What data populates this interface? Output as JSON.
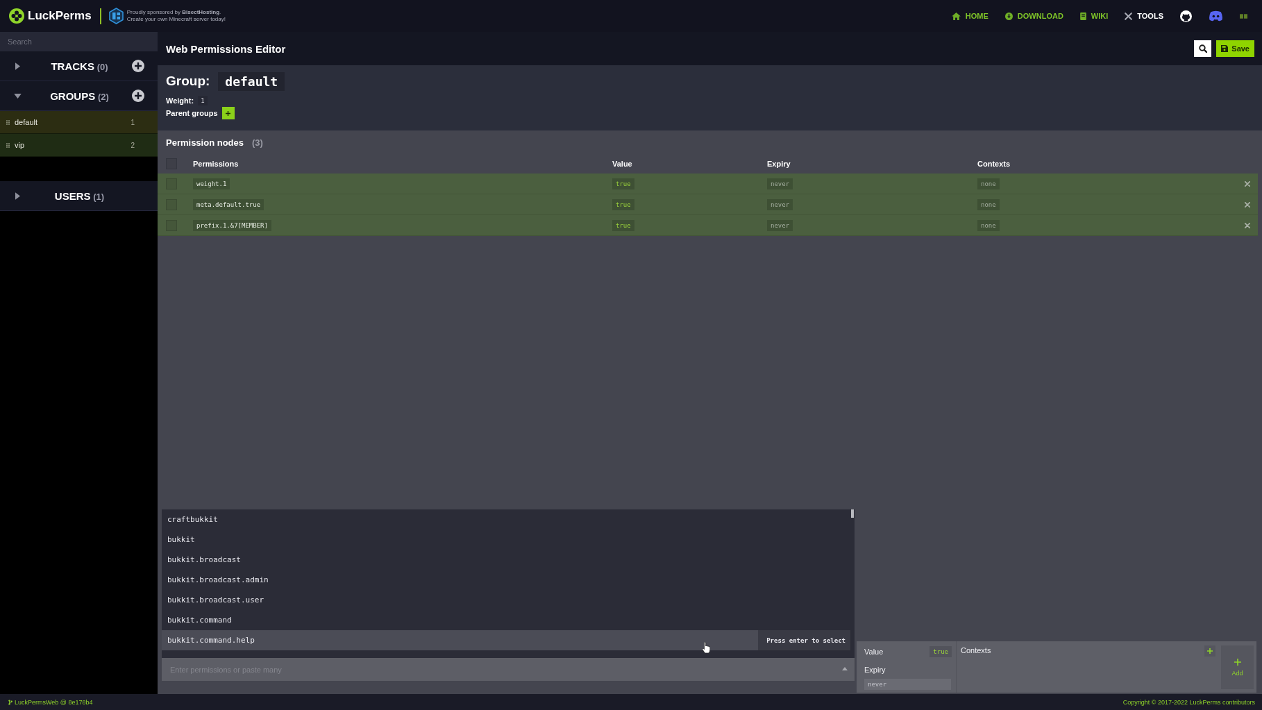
{
  "header": {
    "logo": "LuckPerms",
    "sponsor": [
      "Proudly sponsored by **BisectHosting**.",
      "Create your own Minecraft server today!"
    ],
    "nav": [
      {
        "label": "HOME",
        "selected": false
      },
      {
        "label": "DOWNLOAD",
        "selected": false
      },
      {
        "label": "WIKI",
        "selected": false
      },
      {
        "label": "TOOLS",
        "selected": true
      }
    ]
  },
  "sidebar": {
    "search_placeholder": "Search",
    "sections": [
      {
        "title": "TRACKS",
        "count": "(0)",
        "expanded": false,
        "can_add": true
      },
      {
        "title": "GROUPS",
        "count": "(2)",
        "expanded": true,
        "can_add": true,
        "items": [
          {
            "name": "default",
            "weight": "1",
            "selected": true
          },
          {
            "name": "vip",
            "weight": "2",
            "selected": false
          }
        ]
      },
      {
        "title": "USERS",
        "count": "(1)",
        "expanded": false,
        "can_add": false
      }
    ]
  },
  "editor": {
    "title": "Web Permissions Editor",
    "save_label": "Save",
    "group_label": "Group:",
    "group_name": "default",
    "weight_label": "Weight:",
    "weight": "1",
    "parent_groups_label": "Parent groups"
  },
  "permission_nodes": {
    "title": "Permission nodes",
    "count": "(3)",
    "all_checked": false,
    "columns": [
      "Permissions",
      "Value",
      "Expiry",
      "Contexts"
    ],
    "rows": [
      {
        "permission": "weight.1",
        "value": "true",
        "expiry": "never",
        "contexts": "none",
        "checked": false
      },
      {
        "permission": "meta.default.true",
        "value": "true",
        "expiry": "never",
        "contexts": "none",
        "checked": false
      },
      {
        "permission": "prefix.1.&7[MEMBER]",
        "value": "true",
        "expiry": "never",
        "contexts": "none",
        "checked": false
      }
    ]
  },
  "add_node": {
    "suggestions": [
      {
        "label": "craftbukkit",
        "selected": false
      },
      {
        "label": "bukkit",
        "selected": false
      },
      {
        "label": "bukkit.broadcast",
        "selected": false
      },
      {
        "label": "bukkit.broadcast.admin",
        "selected": false
      },
      {
        "label": "bukkit.broadcast.user",
        "selected": false
      },
      {
        "label": "bukkit.command",
        "selected": false
      },
      {
        "label": "bukkit.command.help",
        "selected": true
      }
    ],
    "hint": "Press enter to select",
    "placeholder": "Enter permissions or paste many",
    "value_label": "Value",
    "value": "true",
    "expiry_label": "Expiry",
    "expiry_placeholder": "never",
    "contexts_label": "Contexts",
    "add_label": "Add"
  },
  "footer": {
    "version": "LuckPermsWeb @ 8e178b4",
    "copyright": "Copyright © 2017-2022 LuckPerms contributors"
  }
}
